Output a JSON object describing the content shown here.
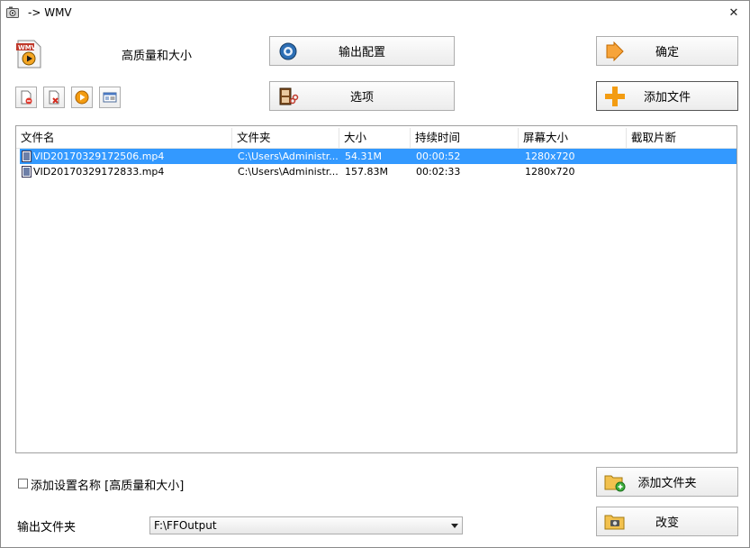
{
  "window": {
    "title": "-> WMV",
    "close_glyph": "✕"
  },
  "preset": {
    "name": "高质量和大小",
    "icon": "wmv-file-icon"
  },
  "buttons": {
    "output_config": "输出配置",
    "options": "选项",
    "ok": "确定",
    "add_file": "添加文件",
    "add_folder": "添加文件夹",
    "change": "改变"
  },
  "toolbar": [
    "remove-file-icon",
    "clear-list-icon",
    "play-icon",
    "media-info-icon"
  ],
  "table": {
    "columns": [
      "文件名",
      "文件夹",
      "大小",
      "持续时间",
      "屏幕大小",
      "截取片断"
    ],
    "rows": [
      {
        "name": "VID20170329172506.mp4",
        "folder": "C:\\Users\\Administr...",
        "size": "54.31M",
        "duration": "00:00:52",
        "screen": "1280x720",
        "clip": "",
        "selected": true
      },
      {
        "name": "VID20170329172833.mp4",
        "folder": "C:\\Users\\Administr...",
        "size": "157.83M",
        "duration": "00:02:33",
        "screen": "1280x720",
        "clip": "",
        "selected": false
      }
    ]
  },
  "options": {
    "add_preset_name_label": "添加设置名称 [高质量和大小]",
    "add_preset_name_checked": false
  },
  "output": {
    "label": "输出文件夹",
    "folder": "F:\\FFOutput"
  },
  "colors": {
    "selection": "#3399ff",
    "accent_orange": "#f5a623"
  }
}
